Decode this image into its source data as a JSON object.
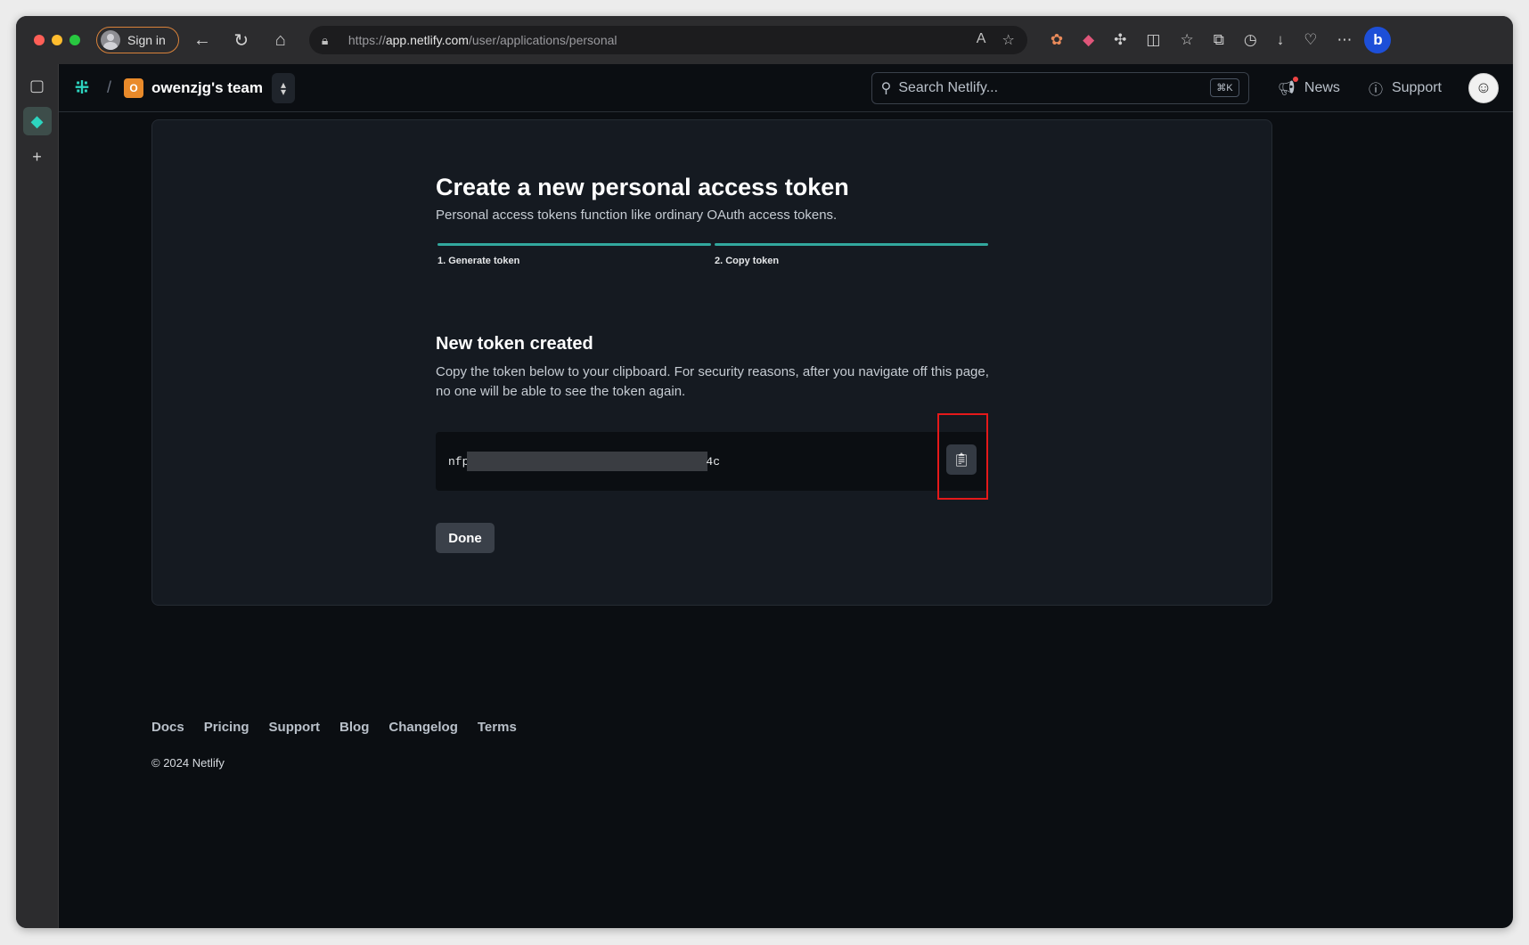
{
  "browser": {
    "signin_label": "Sign in",
    "url_scheme": "https://",
    "url_host": "app.netlify.com",
    "url_path": "/user/applications/personal"
  },
  "header": {
    "team_initial": "O",
    "team_name": "owenzjg's team",
    "search_placeholder": "Search Netlify...",
    "search_shortcut": "⌘K",
    "news_label": "News",
    "support_label": "Support"
  },
  "card": {
    "title": "Create a new personal access token",
    "subtitle": "Personal access tokens function like ordinary OAuth access tokens.",
    "steps": [
      {
        "label": "1. Generate token"
      },
      {
        "label": "2. Copy token"
      }
    ],
    "section_title": "New token created",
    "description": "Copy the token below to your clipboard. For security reasons, after you navigate off this page, no one will be able to see the token again.",
    "token_prefix": "nfp",
    "token_suffix": "4c",
    "done_label": "Done"
  },
  "footer": {
    "links": [
      "Docs",
      "Pricing",
      "Support",
      "Blog",
      "Changelog",
      "Terms"
    ],
    "copyright": "© 2024 Netlify"
  },
  "colors": {
    "accent": "#32a89e",
    "team_avatar": "#e98a2a",
    "highlight": "#e5191a"
  }
}
